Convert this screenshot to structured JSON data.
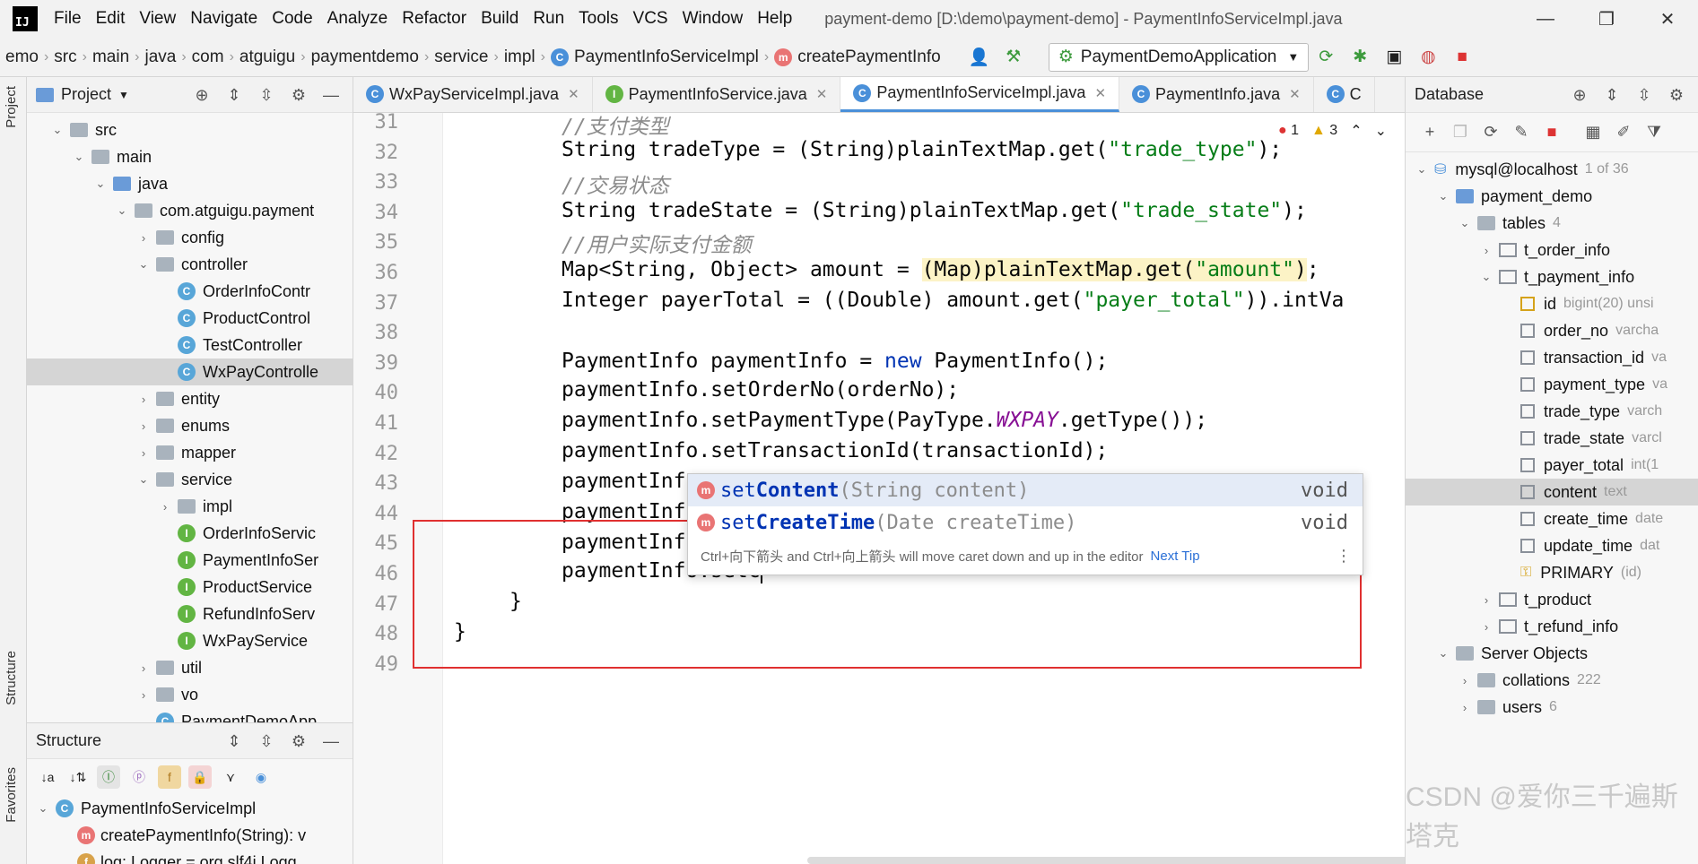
{
  "menubar": {
    "items": [
      "File",
      "Edit",
      "View",
      "Navigate",
      "Code",
      "Analyze",
      "Refactor",
      "Build",
      "Run",
      "Tools",
      "VCS",
      "Window",
      "Help"
    ],
    "title": "payment-demo [D:\\demo\\payment-demo] - PaymentInfoServiceImpl.java"
  },
  "breadcrumb": {
    "items": [
      "emo",
      "src",
      "main",
      "java",
      "com",
      "atguigu",
      "paymentdemo",
      "service",
      "impl",
      "PaymentInfoServiceImpl",
      "createPaymentInfo"
    ],
    "run_config": "PaymentDemoApplication"
  },
  "left_strip": {
    "project": "Project",
    "structure": "Structure",
    "favorites": "Favorites"
  },
  "project": {
    "title": "Project",
    "tree": [
      {
        "label": "src",
        "indent": 1,
        "type": "folder",
        "arrow": "v"
      },
      {
        "label": "main",
        "indent": 2,
        "type": "folder",
        "arrow": "v"
      },
      {
        "label": "java",
        "indent": 3,
        "type": "folder-blue",
        "arrow": "v"
      },
      {
        "label": "com.atguigu.payment",
        "indent": 4,
        "type": "folder",
        "arrow": "v"
      },
      {
        "label": "config",
        "indent": 5,
        "type": "folder",
        "arrow": ">"
      },
      {
        "label": "controller",
        "indent": 5,
        "type": "folder",
        "arrow": "v"
      },
      {
        "label": "OrderInfoContr",
        "indent": 6,
        "type": "class",
        "arrow": ""
      },
      {
        "label": "ProductControl",
        "indent": 6,
        "type": "class",
        "arrow": ""
      },
      {
        "label": "TestController",
        "indent": 6,
        "type": "class",
        "arrow": ""
      },
      {
        "label": "WxPayControlle",
        "indent": 6,
        "type": "class",
        "arrow": "",
        "selected": true
      },
      {
        "label": "entity",
        "indent": 5,
        "type": "folder",
        "arrow": ">"
      },
      {
        "label": "enums",
        "indent": 5,
        "type": "folder",
        "arrow": ">"
      },
      {
        "label": "mapper",
        "indent": 5,
        "type": "folder",
        "arrow": ">"
      },
      {
        "label": "service",
        "indent": 5,
        "type": "folder",
        "arrow": "v"
      },
      {
        "label": "impl",
        "indent": 6,
        "type": "folder",
        "arrow": ">"
      },
      {
        "label": "OrderInfoServic",
        "indent": 6,
        "type": "interface",
        "arrow": ""
      },
      {
        "label": "PaymentInfoSer",
        "indent": 6,
        "type": "interface",
        "arrow": ""
      },
      {
        "label": "ProductService",
        "indent": 6,
        "type": "interface",
        "arrow": ""
      },
      {
        "label": "RefundInfoServ",
        "indent": 6,
        "type": "interface",
        "arrow": ""
      },
      {
        "label": "WxPayService",
        "indent": 6,
        "type": "interface",
        "arrow": ""
      },
      {
        "label": "util",
        "indent": 5,
        "type": "folder",
        "arrow": ">"
      },
      {
        "label": "vo",
        "indent": 5,
        "type": "folder",
        "arrow": ">"
      },
      {
        "label": "PaymentDemoApp",
        "indent": 5,
        "type": "class",
        "arrow": ""
      }
    ]
  },
  "structure": {
    "title": "Structure",
    "items": [
      {
        "label": "PaymentInfoServiceImpl",
        "type": "class"
      },
      {
        "label": "createPaymentInfo(String): v",
        "type": "method"
      },
      {
        "label": "log: Logger = org.slf4j.Logg",
        "type": "field"
      }
    ]
  },
  "tabs": [
    {
      "label": "WxPayServiceImpl.java",
      "active": false
    },
    {
      "label": "PaymentInfoService.java",
      "active": false
    },
    {
      "label": "PaymentInfoServiceImpl.java",
      "active": true
    },
    {
      "label": "PaymentInfo.java",
      "active": false
    },
    {
      "label": "C",
      "active": false
    }
  ],
  "inspections": {
    "errors": "1",
    "warnings": "3"
  },
  "code": {
    "line_numbers": [
      "31",
      "32",
      "33",
      "34",
      "35",
      "36",
      "37",
      "38",
      "39",
      "40",
      "41",
      "42",
      "43",
      "44",
      "45",
      "46",
      "47",
      "48",
      "49"
    ],
    "l31": "//支付类型",
    "l32a": "String tradeType = (String)plainTextMap.get(",
    "l32s": "\"trade_type\"",
    "l32b": ");",
    "l33": "//交易状态",
    "l34a": "String tradeState = (String)plainTextMap.get(",
    "l34s": "\"trade_state\"",
    "l34b": ");",
    "l35": "//用户实际支付金额",
    "l36a": "Map<String, Object> amount = ",
    "l36h": "(Map)plainTextMap.get(",
    "l36s": "\"amount\"",
    "l36h2": ")",
    "l36b": ";",
    "l37a": "Integer payerTotal = ((Double) amount.get(",
    "l37s": "\"payer_total\"",
    "l37b": ")).intVa",
    "l39a": "PaymentInfo paymentInfo = ",
    "l39k": "new",
    "l39b": " PaymentInfo();",
    "l40": "paymentInfo.setOrderNo(orderNo);",
    "l41a": "paymentInfo.setPaymentType(PayType.",
    "l41c": "WXPAY",
    "l41b": ".getType());",
    "l42": "paymentInfo.setTransactionId(transactionId);",
    "l43": "paymentInf",
    "l44": "paymentInf",
    "l45": "paymentInf",
    "l46": "paymentInfo.setc",
    "l47": "}",
    "l48": "}"
  },
  "completion": {
    "items": [
      {
        "prefix": "set",
        "bold": "Content",
        "params": "(String content)",
        "type": "void"
      },
      {
        "prefix": "set",
        "bold": "CreateTime",
        "params": "(Date createTime)",
        "type": "void"
      }
    ],
    "hint": "Ctrl+向下箭头 and Ctrl+向上箭头 will move caret down and up in the editor",
    "next_tip": "Next Tip"
  },
  "database": {
    "title": "Database",
    "rows": [
      {
        "label": "mysql@localhost",
        "extra": "1 of 36",
        "indent": 0,
        "icon": "db",
        "arrow": "v"
      },
      {
        "label": "payment_demo",
        "extra": "",
        "indent": 1,
        "icon": "schema",
        "arrow": "v"
      },
      {
        "label": "tables",
        "extra": "4",
        "indent": 2,
        "icon": "folder",
        "arrow": "v"
      },
      {
        "label": "t_order_info",
        "extra": "",
        "indent": 3,
        "icon": "table",
        "arrow": ">"
      },
      {
        "label": "t_payment_info",
        "extra": "",
        "indent": 3,
        "icon": "table",
        "arrow": "v"
      },
      {
        "label": "id",
        "extra": "bigint(20) unsi",
        "indent": 4,
        "icon": "key-col",
        "arrow": ""
      },
      {
        "label": "order_no",
        "extra": "varcha",
        "indent": 4,
        "icon": "col",
        "arrow": ""
      },
      {
        "label": "transaction_id",
        "extra": "va",
        "indent": 4,
        "icon": "col",
        "arrow": ""
      },
      {
        "label": "payment_type",
        "extra": "va",
        "indent": 4,
        "icon": "col",
        "arrow": ""
      },
      {
        "label": "trade_type",
        "extra": "varch",
        "indent": 4,
        "icon": "col",
        "arrow": ""
      },
      {
        "label": "trade_state",
        "extra": "varcl",
        "indent": 4,
        "icon": "col",
        "arrow": ""
      },
      {
        "label": "payer_total",
        "extra": "int(1",
        "indent": 4,
        "icon": "col",
        "arrow": ""
      },
      {
        "label": "content",
        "extra": "text",
        "indent": 4,
        "icon": "col",
        "arrow": "",
        "selected": true
      },
      {
        "label": "create_time",
        "extra": "date",
        "indent": 4,
        "icon": "col",
        "arrow": ""
      },
      {
        "label": "update_time",
        "extra": "dat",
        "indent": 4,
        "icon": "col",
        "arrow": ""
      },
      {
        "label": "PRIMARY",
        "extra": "(id)",
        "indent": 4,
        "icon": "key",
        "arrow": ""
      },
      {
        "label": "t_product",
        "extra": "",
        "indent": 3,
        "icon": "table",
        "arrow": ">"
      },
      {
        "label": "t_refund_info",
        "extra": "",
        "indent": 3,
        "icon": "table",
        "arrow": ">"
      },
      {
        "label": "Server Objects",
        "extra": "",
        "indent": 1,
        "icon": "folder",
        "arrow": "v"
      },
      {
        "label": "collations",
        "extra": "222",
        "indent": 2,
        "icon": "folder",
        "arrow": ">"
      },
      {
        "label": "users",
        "extra": "6",
        "indent": 2,
        "icon": "folder",
        "arrow": ">"
      }
    ]
  },
  "watermark": "CSDN @爱你三千遍斯塔克"
}
